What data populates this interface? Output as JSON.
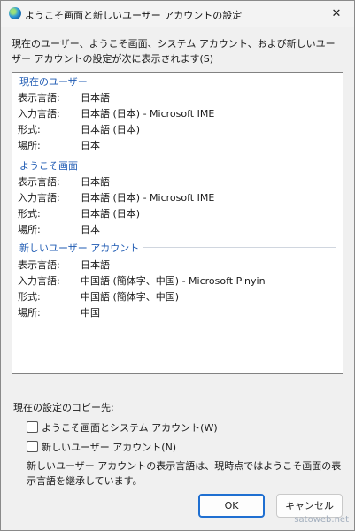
{
  "window": {
    "title": "ようこそ画面と新しいユーザー アカウントの設定",
    "close_glyph": "✕"
  },
  "intro_text": "現在のユーザー、ようこそ画面、システム アカウント、および新しいユーザー アカウントの設定が次に表示されます(S)",
  "groups": [
    {
      "title": "現在のユーザー",
      "rows": [
        {
          "key": "表示言語:",
          "value": "日本語"
        },
        {
          "key": "入力言語:",
          "value": "日本語 (日本) - Microsoft IME"
        },
        {
          "key": "形式:",
          "value": "日本語 (日本)"
        },
        {
          "key": "場所:",
          "value": "日本"
        }
      ]
    },
    {
      "title": "ようこそ画面",
      "rows": [
        {
          "key": "表示言語:",
          "value": "日本語"
        },
        {
          "key": "入力言語:",
          "value": "日本語 (日本) - Microsoft IME"
        },
        {
          "key": "形式:",
          "value": "日本語 (日本)"
        },
        {
          "key": "場所:",
          "value": "日本"
        }
      ]
    },
    {
      "title": "新しいユーザー アカウント",
      "rows": [
        {
          "key": "表示言語:",
          "value": "日本語"
        },
        {
          "key": "入力言語:",
          "value": "中国語 (簡体字、中国) - Microsoft Pinyin"
        },
        {
          "key": "形式:",
          "value": "中国語 (簡体字、中国)"
        },
        {
          "key": "場所:",
          "value": "中国"
        }
      ]
    }
  ],
  "copy": {
    "title": "現在の設定のコピー先:",
    "option_welcome": "ようこそ画面とシステム アカウント(W)",
    "option_new_user": "新しいユーザー アカウント(N)",
    "note": "新しいユーザー アカウントの表示言語は、現時点ではようこそ画面の表示言語を継承しています。"
  },
  "buttons": {
    "ok": "OK",
    "cancel": "キャンセル"
  },
  "watermark": "satoweb.net"
}
